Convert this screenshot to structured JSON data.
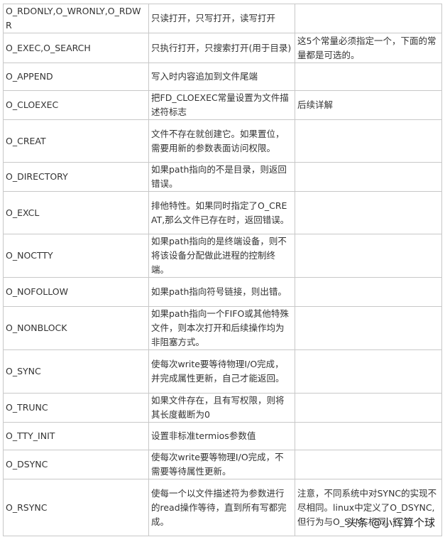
{
  "rows": [
    {
      "flag": "O_RDONLY,O_WRONLY,O_RDWR",
      "desc": "只读打开，只写打开，读写打开",
      "note": ""
    },
    {
      "flag": "O_EXEC,O_SEARCH",
      "desc": "只执行打开，只搜索打开(用于目录)",
      "note": "这5个常量必须指定一个，下面的常量都是可选的。"
    },
    {
      "flag": "O_APPEND",
      "desc": "写入时内容追加到文件尾端",
      "note": ""
    },
    {
      "flag": "O_CLOEXEC",
      "desc": "把FD_CLOEXEC常量设置为文件描述符标志",
      "note": "后续详解"
    },
    {
      "flag": "O_CREAT",
      "desc": "文件不存在就创建它。如果置位，需要用新的参数表面访问权限。",
      "note": ""
    },
    {
      "flag": "O_DIRECTORY",
      "desc": "如果path指向的不是目录，则返回错误。",
      "note": ""
    },
    {
      "flag": "O_EXCL",
      "desc": "排他特性。如果同时指定了O_CREAT,那么文件已存在时，返回错误。",
      "note": ""
    },
    {
      "flag": "O_NOCTTY",
      "desc": "如果path指向的是终端设备，则不将该设备分配做此进程的控制终端。",
      "note": ""
    },
    {
      "flag": "O_NOFOLLOW",
      "desc": "如果path指向符号链接，则出错。",
      "note": ""
    },
    {
      "flag": "O_NONBLOCK",
      "desc": "如果path指向一个FIFO或其他特殊文件，则本次打开和后续操作均为非阻塞方式。",
      "note": ""
    },
    {
      "flag": "O_SYNC",
      "desc": "使每次write要等待物理I/O完成，并完成属性更新，自己才能返回。",
      "note": ""
    },
    {
      "flag": "O_TRUNC",
      "desc": "如果文件存在，且有写权限，则将其长度截断为0",
      "note": ""
    },
    {
      "flag": "O_TTY_INIT",
      "desc": "设置非标准termios参数值",
      "note": ""
    },
    {
      "flag": "O_DSYNC",
      "desc": "使每次write要等物理I/O完成，不需要等待属性更新。",
      "note": ""
    },
    {
      "flag": "O_RSYNC",
      "desc": "使每一个以文件描述符为参数进行的read操作等待，直到所有写都完成。",
      "note": "注意，不同系统中对SYNC的实现不尽相同。linux中定义了O_DSYNC,但行为与O_SYNC相同。"
    }
  ],
  "watermark": "头条 @小辉算个球"
}
